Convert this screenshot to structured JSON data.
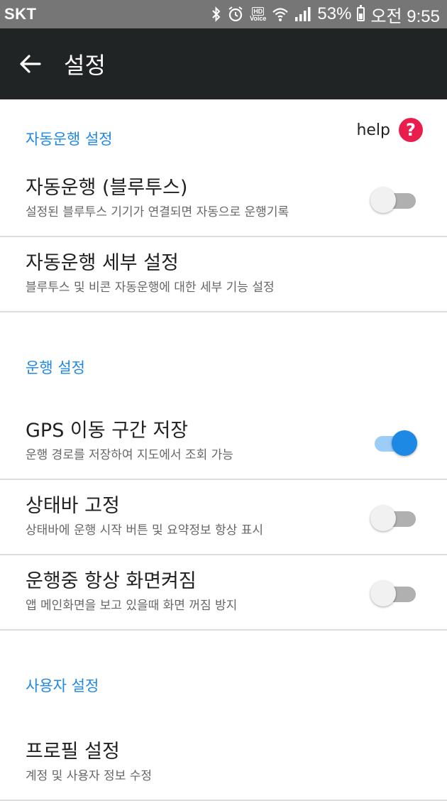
{
  "status_bar": {
    "carrier": "SKT",
    "battery": "53%",
    "time": "오전 9:55",
    "hd_label": "HD",
    "voice_label": "Voice"
  },
  "app_bar": {
    "title": "설정"
  },
  "sections": [
    {
      "header": "자동운행 설정",
      "help_label": "help",
      "items": [
        {
          "title": "자동운행 (블루투스)",
          "subtitle": "설정된 블루투스 기기가 연결되면 자동으로 운행기록",
          "toggle": false
        },
        {
          "title": "자동운행 세부 설정",
          "subtitle": "블루투스 및 비콘 자동운행에 대한 세부 기능 설정"
        }
      ]
    },
    {
      "header": "운행 설정",
      "items": [
        {
          "title": "GPS 이동 구간 저장",
          "subtitle": "운행 경로를 저장하여 지도에서 조회 가능",
          "toggle": true
        },
        {
          "title": "상태바 고정",
          "subtitle": "상태바에 운행 시작 버튼 및 요약정보 항상 표시",
          "toggle": false
        },
        {
          "title": "운행중 항상 화면켜짐",
          "subtitle": "앱 메인화면을 보고 있을때 화면 꺼짐 방지",
          "toggle": false
        }
      ]
    },
    {
      "header": "사용자 설정",
      "items": [
        {
          "title": "프로필 설정",
          "subtitle": "계정 및 사용자 정보 수정"
        }
      ]
    }
  ],
  "colors": {
    "accent": "#1e88e5",
    "app_bar": "#212425",
    "status_bar": "#767676",
    "help": "#e91e4c"
  },
  "icons": {
    "back": "arrow-left-icon",
    "help": "question-circle-icon",
    "bluetooth": "bluetooth-icon",
    "alarm": "alarm-clock-icon",
    "wifi": "wifi-icon",
    "signal": "signal-icon",
    "battery": "battery-icon"
  }
}
